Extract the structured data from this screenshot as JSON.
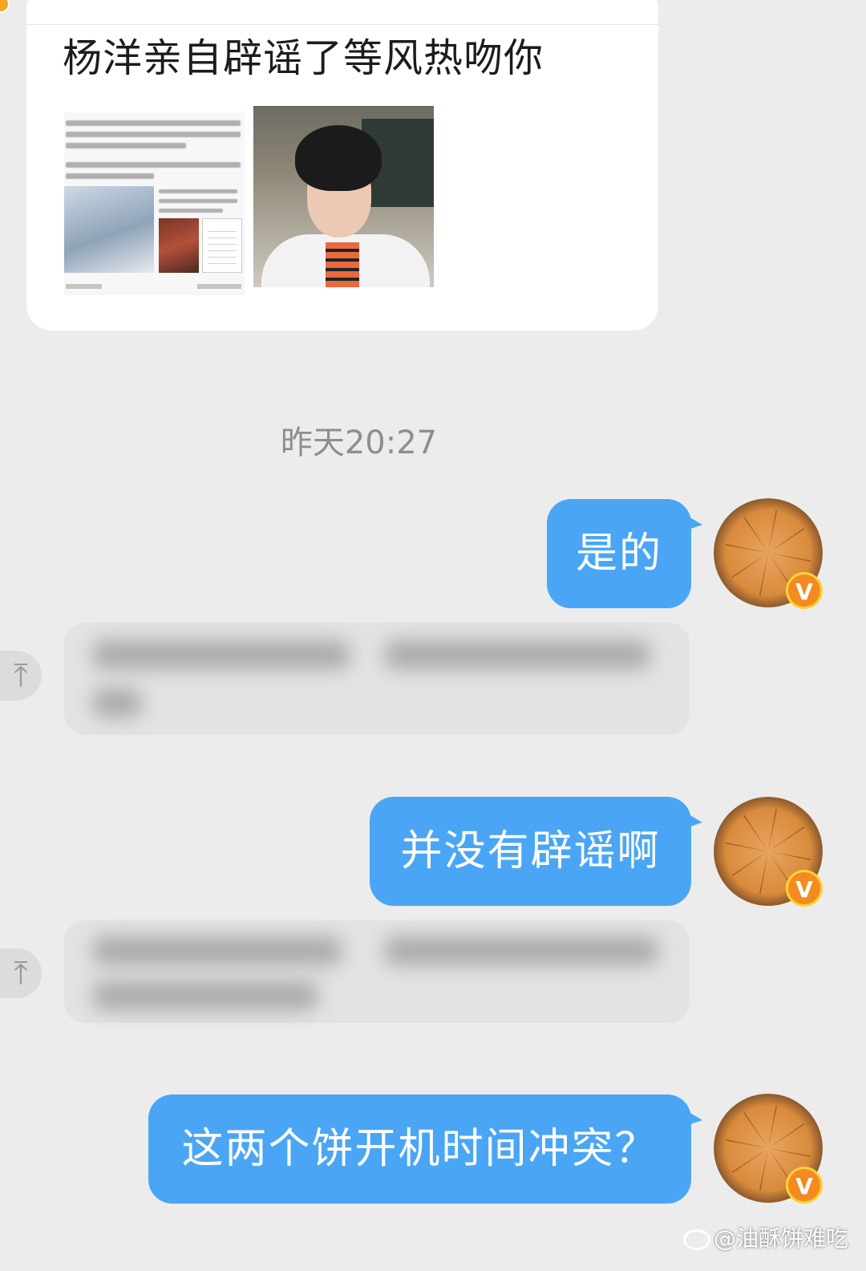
{
  "share_card": {
    "title": "杨洋亲自辟谣了等风热吻你"
  },
  "timestamp": "昨天20:27",
  "messages": {
    "out_1": "是的",
    "out_2": "并没有辟谣啊",
    "out_3": "这两个饼开机时间冲突？"
  },
  "incoming": {
    "pin_icon": "pin-top-icon",
    "content_state": "blurred"
  },
  "avatar": {
    "icon": "pie-avatar",
    "badge": "V"
  },
  "watermark": "@油酥饼难吃",
  "colors": {
    "bubble_out": "#4aa6f5",
    "background": "#ececec",
    "badge": "#f58a1f"
  }
}
